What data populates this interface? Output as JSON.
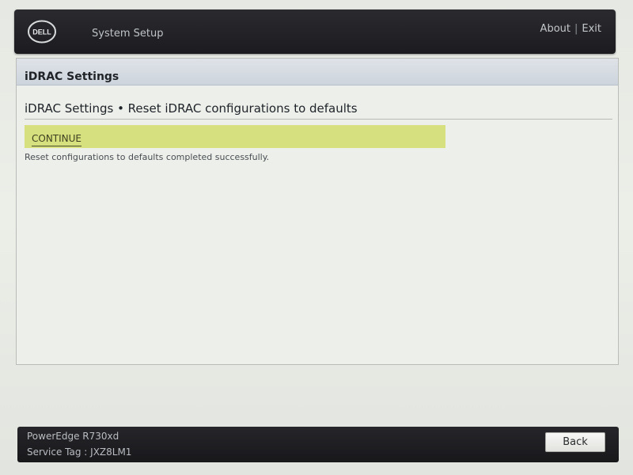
{
  "header": {
    "logo_text": "DELL",
    "title": "System Setup",
    "about_label": "About",
    "separator": "|",
    "exit_label": "Exit"
  },
  "panel": {
    "title": "iDRAC Settings",
    "section_heading": "iDRAC Settings • Reset iDRAC configurations to defaults",
    "continue_label": "CONTINUE",
    "status_message": "Reset configurations to defaults completed successfully."
  },
  "footer": {
    "model": "PowerEdge R730xd",
    "service_tag": "Service Tag : JXZ8LM1",
    "back_label": "Back"
  },
  "colors": {
    "header_bg": "#1f1f23",
    "titlebar_bg": "#d5dbe2",
    "continue_highlight": "#d7e07e",
    "footer_bg": "#1c1c1f"
  },
  "icons": {
    "logo": "dell-logo"
  }
}
